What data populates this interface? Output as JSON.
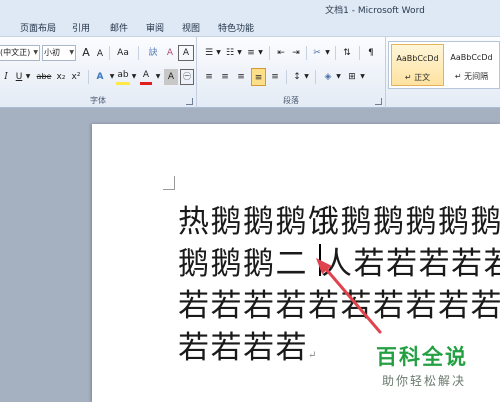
{
  "window": {
    "title": "文档1 - Microsoft Word"
  },
  "tabs": [
    "页面布局",
    "引用",
    "邮件",
    "审阅",
    "视图",
    "特色功能"
  ],
  "ribbon": {
    "font_group": {
      "label": "字体",
      "font_name": "(中文正)",
      "font_size": "小初",
      "grow_font": "A",
      "shrink_font": "A",
      "change_case": "Aa",
      "clear_format": "A",
      "bold": "I",
      "underline": "U",
      "strikethrough": "abe",
      "subscript": "x₂",
      "superscript": "x²",
      "text_effect": "A",
      "highlight": "ab",
      "font_color": "A",
      "char_shading": "A",
      "char_border": "A"
    },
    "paragraph_group": {
      "label": "段落"
    },
    "styles": [
      {
        "sample": "AaBbCcDd",
        "name": "↵ 正文"
      },
      {
        "sample": "AaBbCcDd",
        "name": "↵ 无间隔"
      }
    ]
  },
  "document": {
    "lines": [
      "热鹅鹅鹅饿鹅鹅鹅鹅鹅",
      "鹅鹅鹅二",
      "人若若若若若",
      "若若若若若若若若若若",
      "若若若若"
    ],
    "pilcrow": "↵"
  },
  "watermark": {
    "title": "百科全说",
    "subtitle": "助你轻松解决"
  },
  "colors": {
    "watermark_green": "#24a043",
    "arrow_red": "#e0434e",
    "styles_highlight": "#ffe2a1"
  }
}
